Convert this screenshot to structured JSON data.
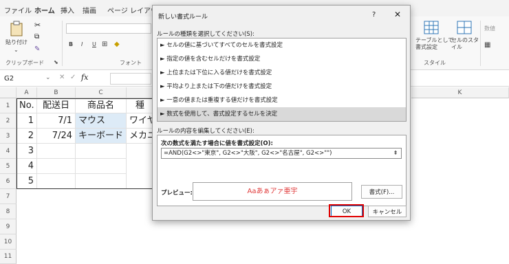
{
  "ribbon": {
    "tabs": [
      "ファイル",
      "ホーム",
      "挿入",
      "描画",
      "ページ レイアウト"
    ],
    "paste_label": "貼り付け",
    "clipboard_label": "クリップボード",
    "font_label": "フォント",
    "style_label": "スタイル",
    "table_format_label": "テーブルとして書式設定",
    "cell_style_label": "セルのスタイル",
    "number_label": "数値"
  },
  "formula_bar": {
    "name_box": "G2"
  },
  "sheet": {
    "columns": [
      "A",
      "B",
      "C",
      "K"
    ],
    "rows": [
      "1",
      "2",
      "3",
      "4",
      "5",
      "6",
      "7",
      "8",
      "9",
      "10",
      "11"
    ],
    "headers": {
      "no": "No.",
      "date": "配送日",
      "product": "商品名",
      "type": "種"
    },
    "data": [
      {
        "no": "1",
        "date": "7/1",
        "product": "マウス",
        "type": "ワイヤ"
      },
      {
        "no": "2",
        "date": "7/24",
        "product": "キーボード",
        "type": "メカニ"
      },
      {
        "no": "3"
      },
      {
        "no": "4"
      },
      {
        "no": "5"
      }
    ]
  },
  "dialog": {
    "title": "新しい書式ルール",
    "help": "?",
    "close": "✕",
    "rule_type_label": "ルールの種類を選択してください(S):",
    "rule_types": [
      "セルの値に基づいてすべてのセルを書式設定",
      "指定の値を含むセルだけを書式設定",
      "上位または下位に入る値だけを書式設定",
      "平均より上または下の値だけを書式設定",
      "一意の値または重複する値だけを書式設定",
      "数式を使用して、書式設定するセルを決定"
    ],
    "rule_bullet": "►",
    "edit_label": "ルールの内容を編集してください(E):",
    "formula_label": "次の数式を満たす場合に値を書式設定(O):",
    "formula": "=AND(G2<>\"東京\", G2<>\"大阪\", G2<>\"名古屋\", G2<>\"\")",
    "collapse": "⇞",
    "preview_label": "プレビュー:",
    "preview_text": "Aaあぁアァ亜宇",
    "format_button": "書式(F)...",
    "ok": "OK",
    "cancel": "キャンセル"
  },
  "colors": {
    "selection_fill": "#ddebf7",
    "accent": "#217346",
    "highlight": "#e00000",
    "preview_text": "#e03a3a"
  }
}
